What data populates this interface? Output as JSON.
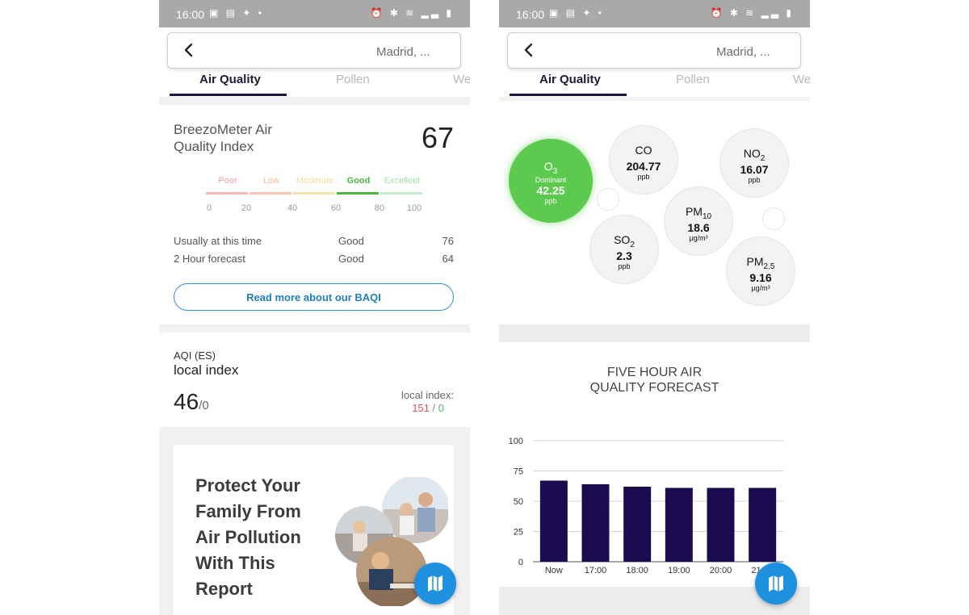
{
  "status_bar": {
    "time": "16:00",
    "left_icons": "▣ ▤ ✦ •",
    "right_icons": "⏰ ✱ ≋ ▂▃ ▮"
  },
  "header": {
    "location": "Madrid, ...",
    "tabs": [
      "Air Quality",
      "Pollen",
      "We"
    ]
  },
  "baqi": {
    "title": "BreezoMeter Air Quality Index",
    "value": "67",
    "scale_labels": [
      {
        "text": "Poor",
        "color": "#f0a0a0"
      },
      {
        "text": "Low",
        "color": "#f4b8a0"
      },
      {
        "text": "Moderate",
        "color": "#f2de9a"
      },
      {
        "text": "Good",
        "color": "#4ab840"
      },
      {
        "text": "Excellent",
        "color": "#9fe0a8"
      }
    ],
    "scale_colors": [
      "#f4b6b6",
      "#f6c2b2",
      "#f2e4a8",
      "#4ab840",
      "#bfeccc"
    ],
    "ticks": [
      "0",
      "20",
      "40",
      "60",
      "80",
      "100"
    ],
    "rows": [
      {
        "label": "Usually at this time",
        "status": "Good",
        "value": "76"
      },
      {
        "label": "2 Hour forecast",
        "status": "Good",
        "value": "64"
      }
    ],
    "read_more": "Read more about our BAQI"
  },
  "aqi_es": {
    "label": "AQI (ES)",
    "sub": "local index",
    "value": "46",
    "suffix": "/0",
    "local_label": "local index:",
    "local_red": "151",
    "local_sep": "/",
    "local_green": "0"
  },
  "promo": {
    "text": "Protect Your Family From Air Pollution With This Report"
  },
  "pollutants": [
    {
      "name": "O",
      "sub": "3",
      "tag": "Dominant",
      "value": "42.25",
      "unit": "ppb",
      "dominant": true
    },
    {
      "name": "CO",
      "sub": "",
      "value": "204.77",
      "unit": "ppb"
    },
    {
      "name": "NO",
      "sub": "2",
      "value": "16.07",
      "unit": "ppb"
    },
    {
      "name": "PM",
      "sub": "10",
      "value": "18.6",
      "unit": "µg/m³"
    },
    {
      "name": "SO",
      "sub": "2",
      "value": "2.3",
      "unit": "ppb"
    },
    {
      "name": "PM",
      "sub": "2.5",
      "value": "9.16",
      "unit": "µg/m³"
    }
  ],
  "forecast": {
    "title_line1": "FIVE HOUR AIR",
    "title_line2": "QUALITY FORECAST"
  },
  "chart_data": {
    "type": "bar",
    "title": "FIVE HOUR AIR QUALITY FORECAST",
    "categories": [
      "Now",
      "17:00",
      "18:00",
      "19:00",
      "20:00",
      "21:00"
    ],
    "values": [
      67,
      64,
      62,
      61,
      61,
      61
    ],
    "ylim": [
      0,
      100
    ],
    "yticks": [
      0,
      25,
      50,
      75,
      100
    ],
    "bar_color": "#1c0c4f",
    "grid": true
  },
  "colors": {
    "accent": "#1e90e0",
    "tab_underline": "#1c1545",
    "dominant": "#5cc94f"
  }
}
